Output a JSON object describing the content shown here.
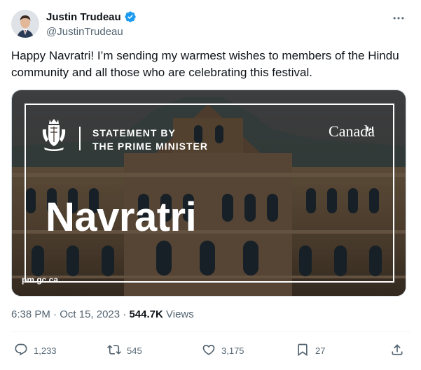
{
  "author": {
    "display_name": "Justin Trudeau",
    "handle": "@JustinTrudeau",
    "verified": true
  },
  "icons": {
    "verified": "verified-badge-icon",
    "more": "more-icon",
    "reply": "reply-icon",
    "retweet": "retweet-icon",
    "like": "heart-icon",
    "bookmark": "bookmark-icon",
    "share": "share-icon"
  },
  "tweet": {
    "text": "Happy Navratri! I’m sending my warmest wishes to members of the Hindu community and all those who are celebrating this festival."
  },
  "media": {
    "statement_line1": "STATEMENT BY",
    "statement_line2": "THE PRIME MINISTER",
    "wordmark": "Canada",
    "title": "Navratri",
    "site": "pm.gc.ca"
  },
  "meta": {
    "time": "6:38 PM",
    "separator": " · ",
    "date": "Oct 15, 2023",
    "views_count": "544.7K",
    "views_label": "Views"
  },
  "actions": {
    "replies": "1,233",
    "retweets": "545",
    "likes": "3,175",
    "bookmarks": "27"
  },
  "colors": {
    "text_primary": "#0f1419",
    "text_secondary": "#536471",
    "verified_blue": "#1d9bf0",
    "border": "#cfd9de"
  }
}
